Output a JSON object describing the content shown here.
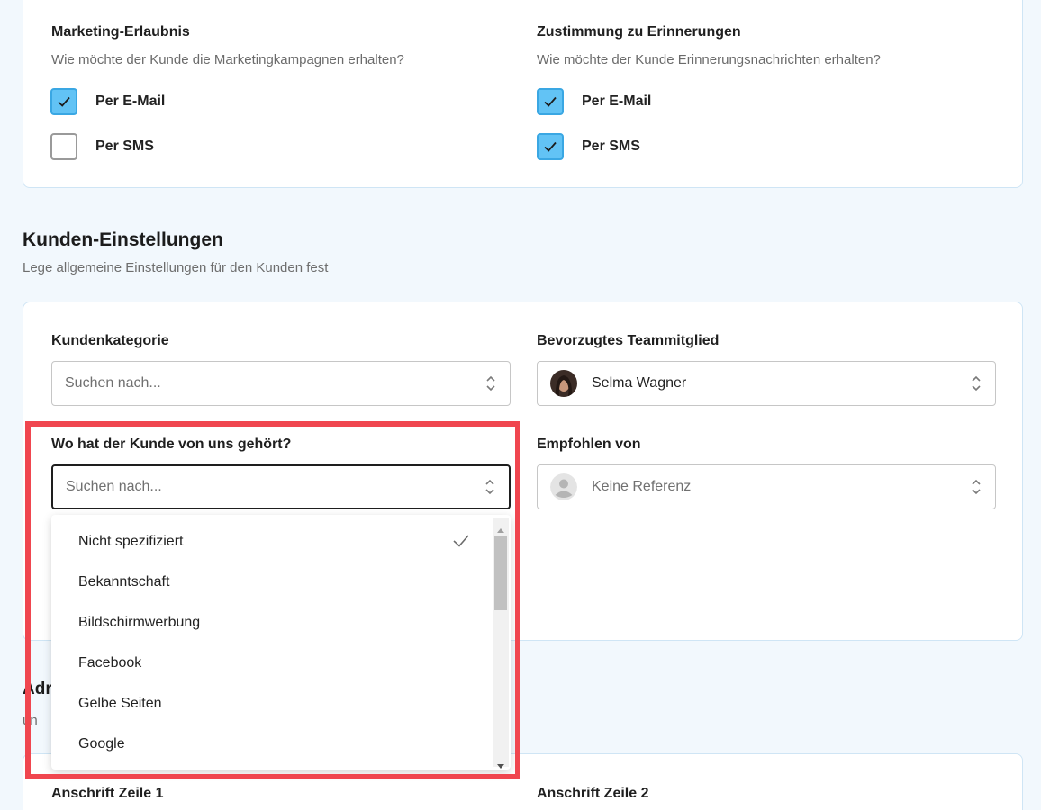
{
  "marketing": {
    "title": "Marketing-Erlaubnis",
    "subtitle": "Wie möchte der Kunde die Marketingkampagnen erhalten?",
    "options": [
      {
        "label": "Per E-Mail",
        "checked": true
      },
      {
        "label": "Per SMS",
        "checked": false
      }
    ]
  },
  "reminders": {
    "title": "Zustimmung zu Erinnerungen",
    "subtitle": "Wie möchte der Kunde Erinnerungsnachrichten erhalten?",
    "options": [
      {
        "label": "Per E-Mail",
        "checked": true
      },
      {
        "label": "Per SMS",
        "checked": true
      }
    ]
  },
  "customer_settings": {
    "title": "Kunden-Einstellungen",
    "subtitle": "Lege allgemeine Einstellungen für den Kunden fest",
    "category": {
      "label": "Kundenkategorie",
      "placeholder": "Suchen nach..."
    },
    "team_member": {
      "label": "Bevorzugtes Teammitglied",
      "value": "Selma Wagner"
    },
    "source": {
      "label": "Wo hat der Kunde von uns gehört?",
      "placeholder": "Suchen nach..."
    },
    "referred_by": {
      "label": "Empfohlen von",
      "value": "Keine Referenz"
    }
  },
  "source_dropdown": {
    "items": [
      {
        "label": "Nicht spezifiziert",
        "selected": true
      },
      {
        "label": "Bekanntschaft",
        "selected": false
      },
      {
        "label": "Bildschirmwerbung",
        "selected": false
      },
      {
        "label": "Facebook",
        "selected": false
      },
      {
        "label": "Gelbe Seiten",
        "selected": false
      },
      {
        "label": "Google",
        "selected": false
      }
    ]
  },
  "address": {
    "title_partial": "Adr",
    "subtitle_partial": "un",
    "line1_label": "Anschrift Zeile 1",
    "line2_label": "Anschrift Zeile 2"
  },
  "colors": {
    "checkbox_checked": "#62c3f5",
    "highlight_border": "#f0464f",
    "page_bg": "#f2f8fd",
    "card_border": "#cfe5f5"
  }
}
